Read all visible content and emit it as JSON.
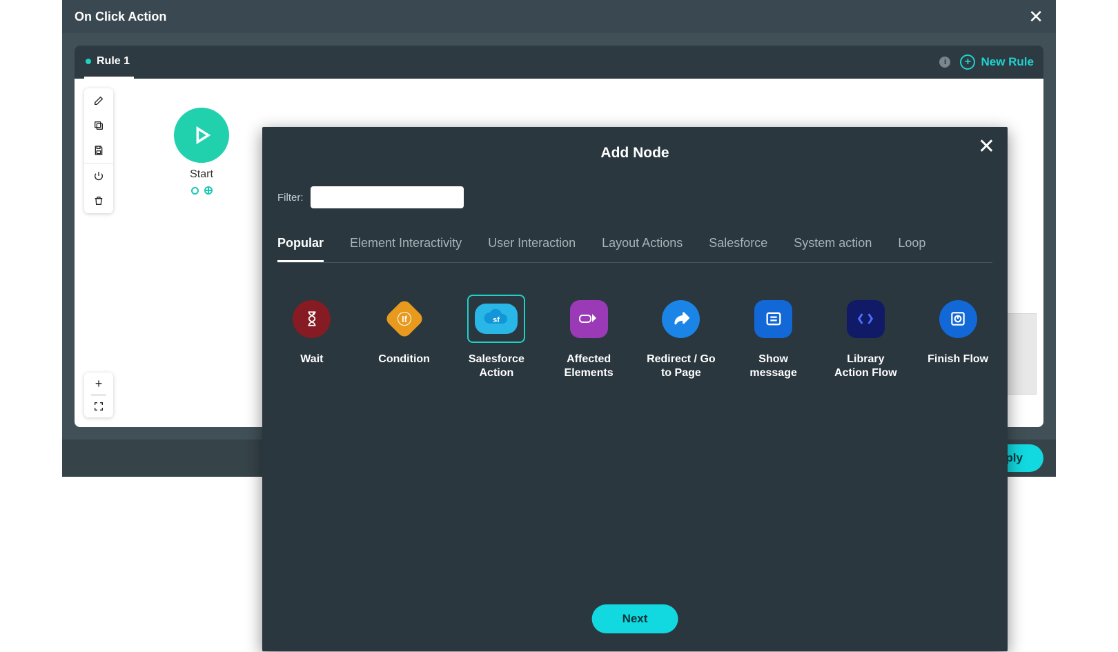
{
  "window": {
    "title": "On Click Action"
  },
  "tabs": {
    "rule1": "Rule 1",
    "new_rule": "New Rule"
  },
  "start_node": {
    "label": "Start"
  },
  "footer": {
    "apply": "Apply"
  },
  "addnode": {
    "title": "Add Node",
    "filter_label": "Filter:",
    "filter_value": "",
    "next": "Next",
    "tabs": [
      "Popular",
      "Element Interactivity",
      "User Interaction",
      "Layout Actions",
      "Salesforce",
      "System action",
      "Loop"
    ],
    "active_tab": 0,
    "cards": {
      "wait": "Wait",
      "condition": "Condition",
      "salesforce": "Salesforce Action",
      "affected": "Affected Elements",
      "redirect": "Redirect / Go to Page",
      "message": "Show message",
      "library": "Library Action Flow",
      "finish": "Finish Flow"
    },
    "selected_card": "salesforce"
  }
}
